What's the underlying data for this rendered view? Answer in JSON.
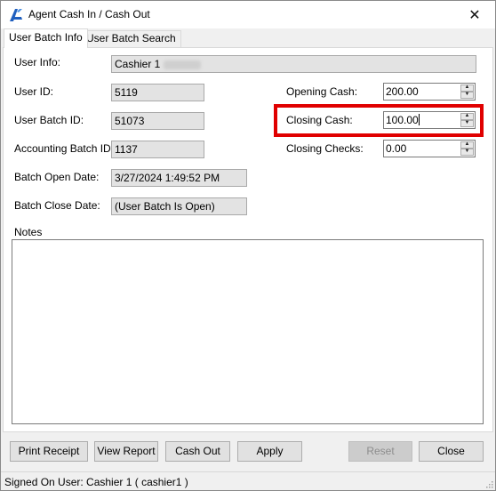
{
  "window": {
    "title": "Agent Cash In / Cash Out",
    "app_icon": "app-logo-icon",
    "close_symbol": "✕"
  },
  "tabs": [
    {
      "label": "User Batch Info",
      "active": true
    },
    {
      "label": "User Batch Search",
      "active": false
    }
  ],
  "fields": {
    "user_info": {
      "label": "User Info:",
      "value": "Cashier 1"
    },
    "user_id": {
      "label": "User ID:",
      "value": "5119"
    },
    "user_batch_id": {
      "label": "User Batch ID:",
      "value": "51073"
    },
    "accounting_batch_id": {
      "label": "Accounting Batch ID:",
      "value": "1137"
    },
    "batch_open_date": {
      "label": "Batch Open Date:",
      "value": "3/27/2024 1:49:52 PM"
    },
    "batch_close_date": {
      "label": "Batch Close Date:",
      "value": "(User Batch Is Open)"
    },
    "opening_cash": {
      "label": "Opening Cash:",
      "value": "200.00"
    },
    "closing_cash": {
      "label": "Closing Cash:",
      "value": "100.00"
    },
    "closing_checks": {
      "label": "Closing Checks:",
      "value": "0.00"
    }
  },
  "notes": {
    "label": "Notes",
    "value": ""
  },
  "buttons": {
    "print_receipt": "Print Receipt",
    "view_report": "View Report",
    "cash_out": "Cash Out",
    "apply": "Apply",
    "reset": "Reset",
    "close": "Close"
  },
  "status": {
    "text": "Signed On User: Cashier 1 ( cashier1 )"
  },
  "colors": {
    "highlight_border": "#e00000",
    "readonly_bg": "#e3e3e3",
    "window_bg": "#f0f0f0"
  }
}
